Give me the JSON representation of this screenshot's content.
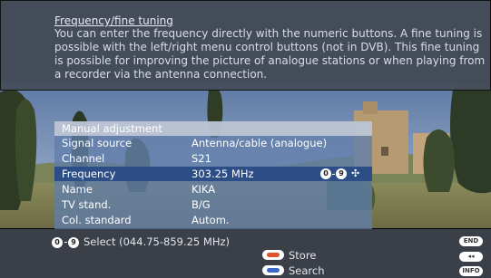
{
  "info": {
    "title": "Frequency/fine tuning",
    "text": "You can enter the frequency directly with the numeric buttons. A fine tuning is possible with the left/right menu control buttons (not in DVB). This fine tuning is possible for improving the picture of analogue stations or when playing from a recorder via the antenna connection."
  },
  "menu": {
    "header": "Manual adjustment",
    "rows": [
      {
        "label": "Signal source",
        "value": "Antenna/cable (analogue)"
      },
      {
        "label": "Channel",
        "value": "S21"
      },
      {
        "label": "Frequency",
        "value": "303.25 MHz"
      },
      {
        "label": "Name",
        "value": "KIKA"
      },
      {
        "label": "TV stand.",
        "value": "B/G"
      },
      {
        "label": "Col. standard",
        "value": "Autom."
      }
    ],
    "selected_index": 2,
    "hint_from": "0",
    "hint_to": "9"
  },
  "footer": {
    "select_from": "0",
    "select_to": "9",
    "select_text": "Select (044.75-859.25 MHz)",
    "store_label": "Store",
    "search_label": "Search",
    "end_label": "END",
    "rewind_label": "◂◂",
    "info_label": "INFO"
  },
  "colors": {
    "store_button": "#e0522a",
    "search_button": "#3b67c9",
    "selected_row": "#2c4d86"
  }
}
